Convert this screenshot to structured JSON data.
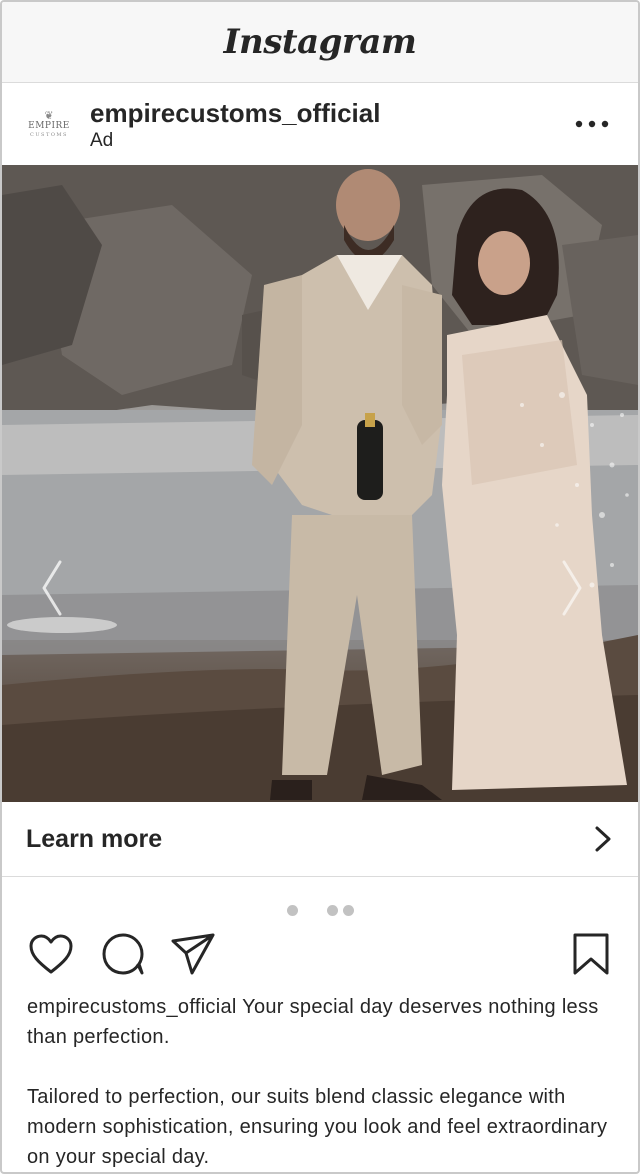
{
  "app": {
    "title": "Instagram"
  },
  "post": {
    "username": "empirecustoms_official",
    "label": "Ad",
    "avatar_logo_top": "EMPIRE",
    "avatar_logo_bottom": "CUSTOMS"
  },
  "cta": {
    "label": "Learn more"
  },
  "carousel": {
    "dot_count": 3,
    "active_index": 1
  },
  "caption": {
    "username": "empirecustoms_official",
    "text": " Your special day deserves nothing less than perfection.",
    "paragraph2": "Tailored to perfection, our suits blend classic elegance with modern sophistication, ensuring you look and feel extraordinary on your special day."
  },
  "icons": {
    "more": "more-options-icon",
    "prev": "chevron-left-icon",
    "next": "chevron-right-icon",
    "cta": "chevron-right-icon",
    "like": "heart-icon",
    "comment": "comment-icon",
    "share": "send-icon",
    "save": "bookmark-icon"
  },
  "colors": {
    "text": "#262626",
    "divider": "#dbdbdb",
    "dot": "#c2c2c2"
  }
}
